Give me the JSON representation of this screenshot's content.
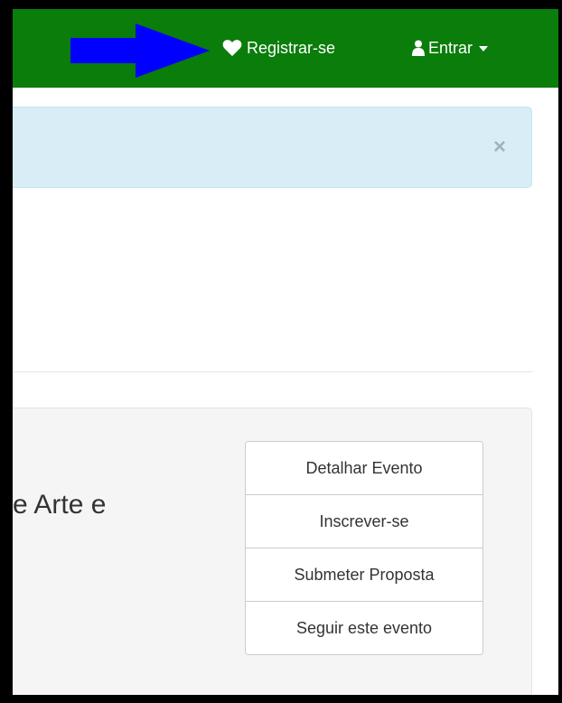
{
  "navbar": {
    "background": "#0a7d0a",
    "register": {
      "icon": "heart-icon",
      "label": "Registrar-se"
    },
    "login": {
      "icon": "user-icon",
      "label": "Entrar",
      "caret_icon": "caret-down-icon"
    },
    "annotation_arrow_color": "#0000ff"
  },
  "alert": {
    "close_label": "×",
    "background": "#d9edf7"
  },
  "event": {
    "title_fragment": "e Arte e",
    "actions": [
      {
        "label": "Detalhar Evento"
      },
      {
        "label": "Inscrever-se"
      },
      {
        "label": "Submeter Proposta"
      },
      {
        "label": "Seguir este evento"
      }
    ]
  }
}
